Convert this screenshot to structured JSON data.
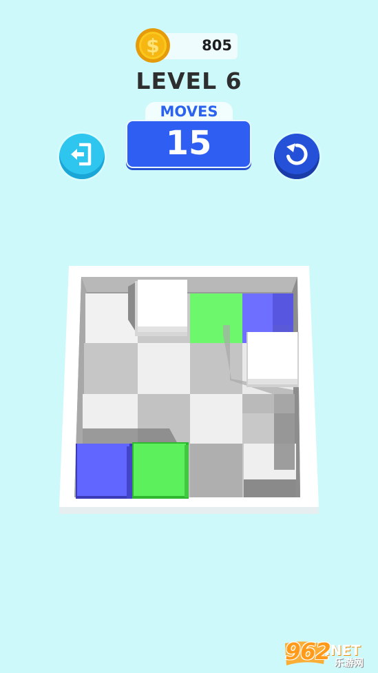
{
  "hud": {
    "coins": "805",
    "level_title": "LEVEL 6",
    "moves_label": "MOVES",
    "moves_value": "15"
  },
  "buttons": {
    "exit": "exit-icon",
    "restart": "restart-icon"
  },
  "board": {
    "blocks": [
      {
        "name": "white-block-1",
        "color": "white"
      },
      {
        "name": "white-block-2",
        "color": "white"
      },
      {
        "name": "purple-block",
        "color": "#6066ff"
      },
      {
        "name": "green-block",
        "color": "#5cf05c"
      }
    ],
    "targets": [
      {
        "name": "green-target-tile",
        "color": "#6cf76c"
      },
      {
        "name": "purple-target-tile",
        "color": "#6e6eff"
      }
    ]
  },
  "watermark": {
    "text": "962",
    "suffix": ".NET",
    "sub": "乐游网"
  },
  "colors": {
    "background": "#cdf9fb",
    "accent_blue": "#2f5ff2",
    "cyan_button": "#2ec6ee",
    "coin_gold": "#f8c21a"
  }
}
